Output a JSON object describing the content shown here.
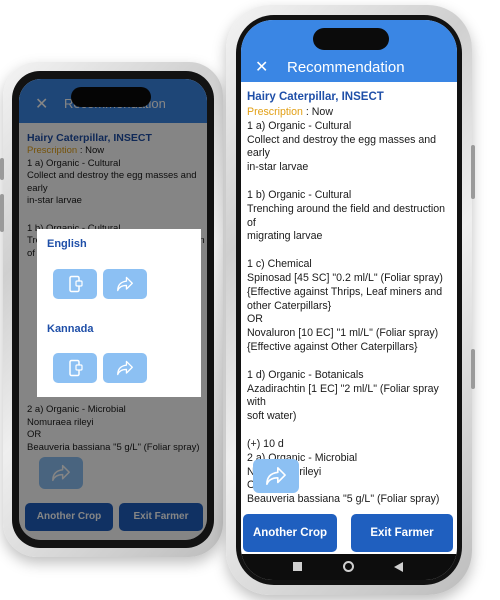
{
  "left": {
    "header_title": "Recommendation",
    "title": "Hairy Caterpillar, INSECT",
    "prescription_label": "Prescription",
    "prescription_value": ": Now",
    "lines": {
      "l1": "1 a) Organic - Cultural",
      "l2": "Collect and destroy the egg masses and early",
      "l3": "in-star larvae",
      "l4": "1 b) Organic - Cultural",
      "l5": "Trenching around the field and destruction of",
      "l6": "2 a) Organic - Microbial",
      "l7": "Nomuraea rileyi",
      "l8": "OR",
      "l9": "Beauveria bassiana \"5 g/L\" (Foliar spray)"
    },
    "dialog": {
      "english": "English",
      "kannada": "Kannada"
    },
    "another_crop": "Another Crop",
    "exit_farmer": "Exit Farmer"
  },
  "right": {
    "header_title": "Recommendation",
    "title": "Hairy Caterpillar, INSECT",
    "prescription_label": "Prescription",
    "prescription_value": ": Now",
    "lines": {
      "l1": "1 a) Organic - Cultural",
      "l2": "Collect and destroy the egg masses and early",
      "l3": "in-star larvae",
      "l4": "1 b) Organic - Cultural",
      "l5": "Trenching around the field and destruction of",
      "l6": "migrating larvae",
      "l7": "1 c)  Chemical",
      "l8": "Spinosad [45 SC] \"0.2 ml/L\" (Foliar spray)",
      "l9": "{Effective against Thrips, Leaf miners and",
      "l10": "other Caterpillars}",
      "l11": "OR",
      "l12": "Novaluron [10 EC] \"1 ml/L\" (Foliar spray)",
      "l13": "{Effective against Other Caterpillars}",
      "l14": "1 d) Organic - Botanicals",
      "l15": "Azadirachtin [1 EC] \"2 ml/L\" (Foliar spray with",
      "l16": "soft water)",
      "l17": "(+) 10 d",
      "l18": "2 a) Organic - Microbial",
      "l19": "Nomuraea rileyi",
      "l20": "OR",
      "l21": "Beauveria bassiana \"5 g/L\" (Foliar spray)"
    },
    "another_crop": "Another Crop",
    "exit_farmer": "Exit Farmer"
  },
  "colors": {
    "header_blue": "#3a86e4",
    "button_blue": "#1f5fbf",
    "title_blue": "#1f4fa8",
    "prescription_orange": "#e2a016",
    "share_blue": "#8cc0f3"
  },
  "icons": [
    "close-icon",
    "phone-icon",
    "share-icon",
    "square-nav-icon",
    "circle-nav-icon",
    "back-nav-icon"
  ]
}
